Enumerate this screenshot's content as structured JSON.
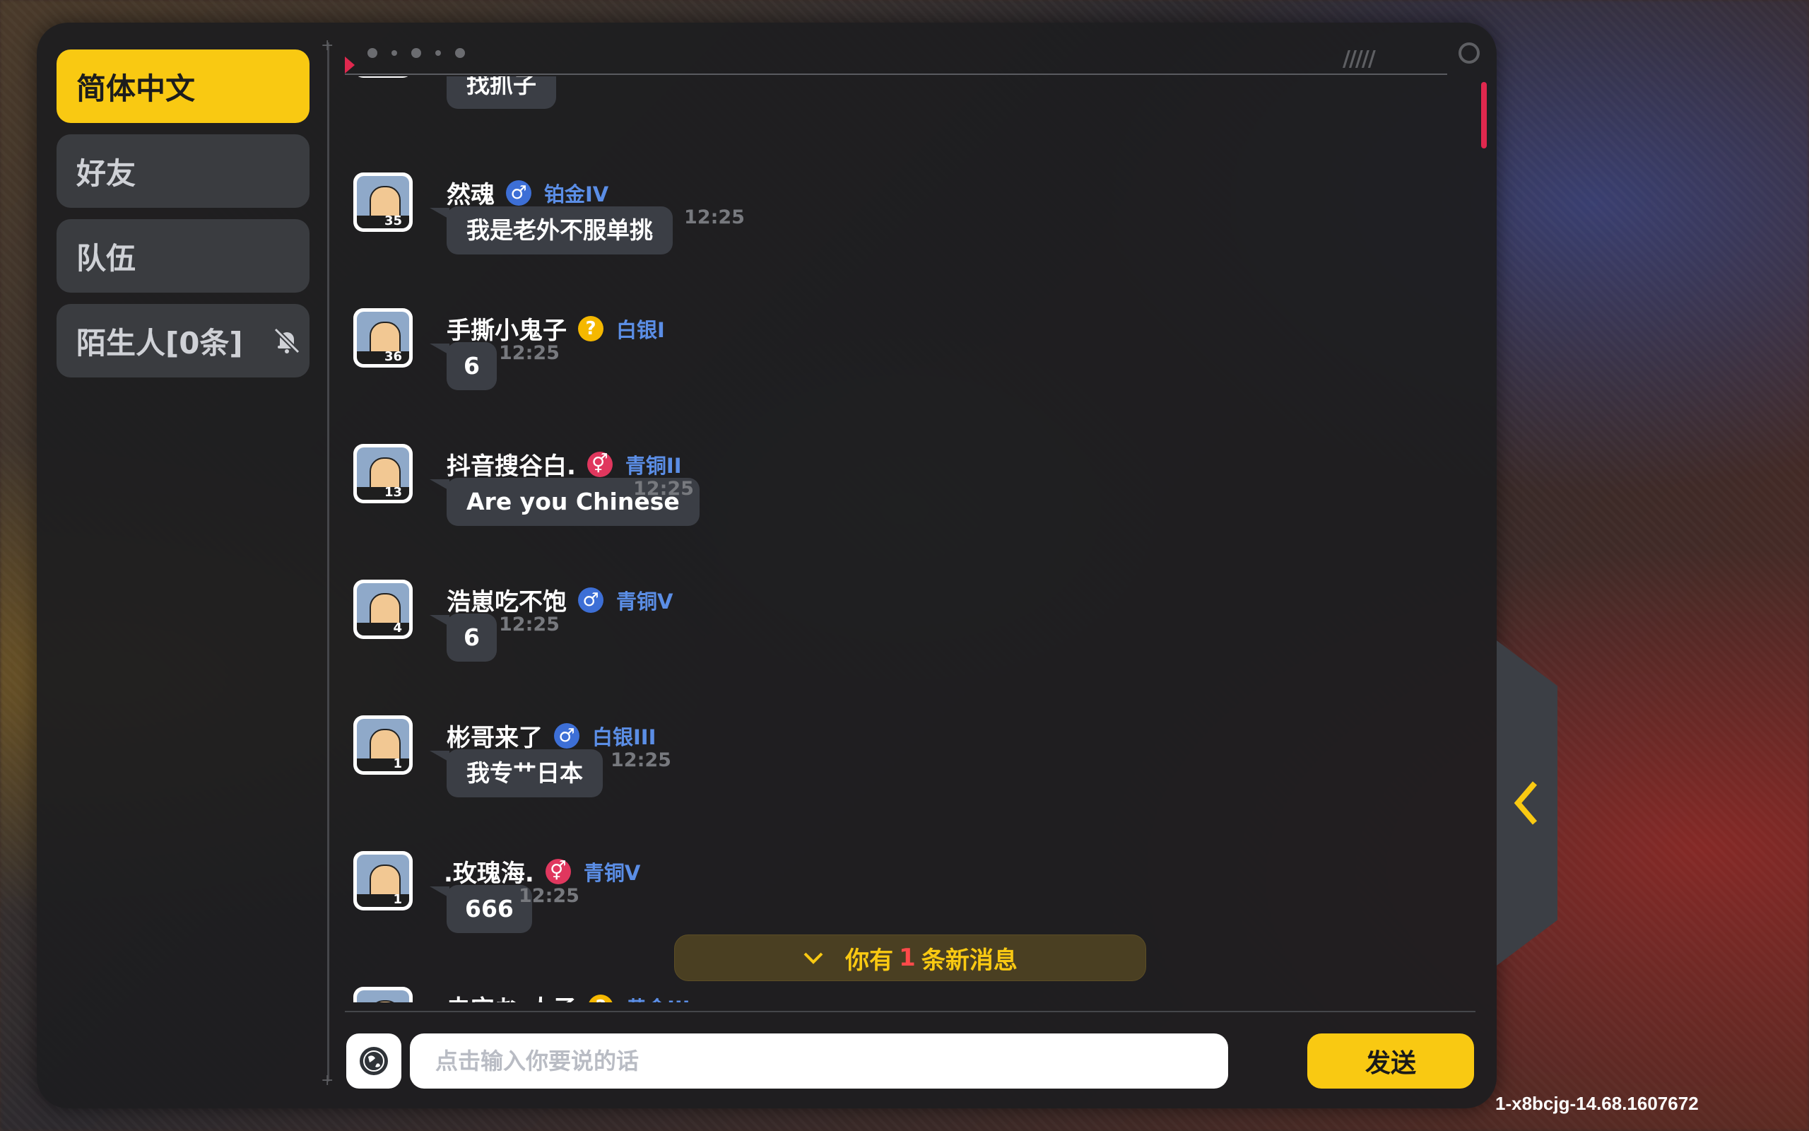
{
  "sidebar": {
    "tabs": [
      {
        "label": "简体中文",
        "active": true
      },
      {
        "label": "好友",
        "active": false
      },
      {
        "label": "队伍",
        "active": false
      },
      {
        "label": "陌生人[0条]",
        "active": false,
        "icon": "mute-icon"
      }
    ]
  },
  "chat": {
    "partial_top": {
      "text": "找抓子"
    },
    "messages": [
      {
        "name": "然魂",
        "gender": "male",
        "rank": "铂金IV",
        "level": "35",
        "text": "我是老外不服单挑",
        "time": "12:25"
      },
      {
        "name": "手撕小鬼子",
        "gender": "unknown",
        "rank": "白银I",
        "level": "36",
        "text": "6",
        "time": "12:25"
      },
      {
        "name": "抖音搜谷白.",
        "gender": "female",
        "rank": "青铜II",
        "level": "13",
        "text": "Are you Chinese",
        "time": "12:25"
      },
      {
        "name": "浩崽吃不饱",
        "gender": "male",
        "rank": "青铜V",
        "level": "4",
        "text": "6",
        "time": "12:25"
      },
      {
        "name": "彬哥来了",
        "gender": "male",
        "rank": "白银III",
        "level": "1",
        "text": "我专艹日本",
        "time": "12:25"
      },
      {
        "name": ".玫瑰海.",
        "gender": "female",
        "rank": "青铜V",
        "level": "1",
        "text": "666",
        "time": "12:25"
      }
    ],
    "partial_bottom": {
      "name": "虫宝お-人子",
      "rank": "黄金III"
    }
  },
  "notice": {
    "prefix": "你有",
    "count": "1",
    "suffix": "条新消息"
  },
  "input": {
    "placeholder": "点击输入你要说的话",
    "value": ""
  },
  "send_label": "发送",
  "version": "1-x8bcjg-14.68.1607672",
  "colors": {
    "accent": "#f9c912",
    "rank_blue": "#5b8ee6",
    "male": "#3d6fd6",
    "female": "#e0375e",
    "panel": "#1e1e20",
    "highlight_red": "#e0284e"
  },
  "gender_symbols": {
    "male": "♂",
    "female": "⚥",
    "unknown": "?"
  }
}
